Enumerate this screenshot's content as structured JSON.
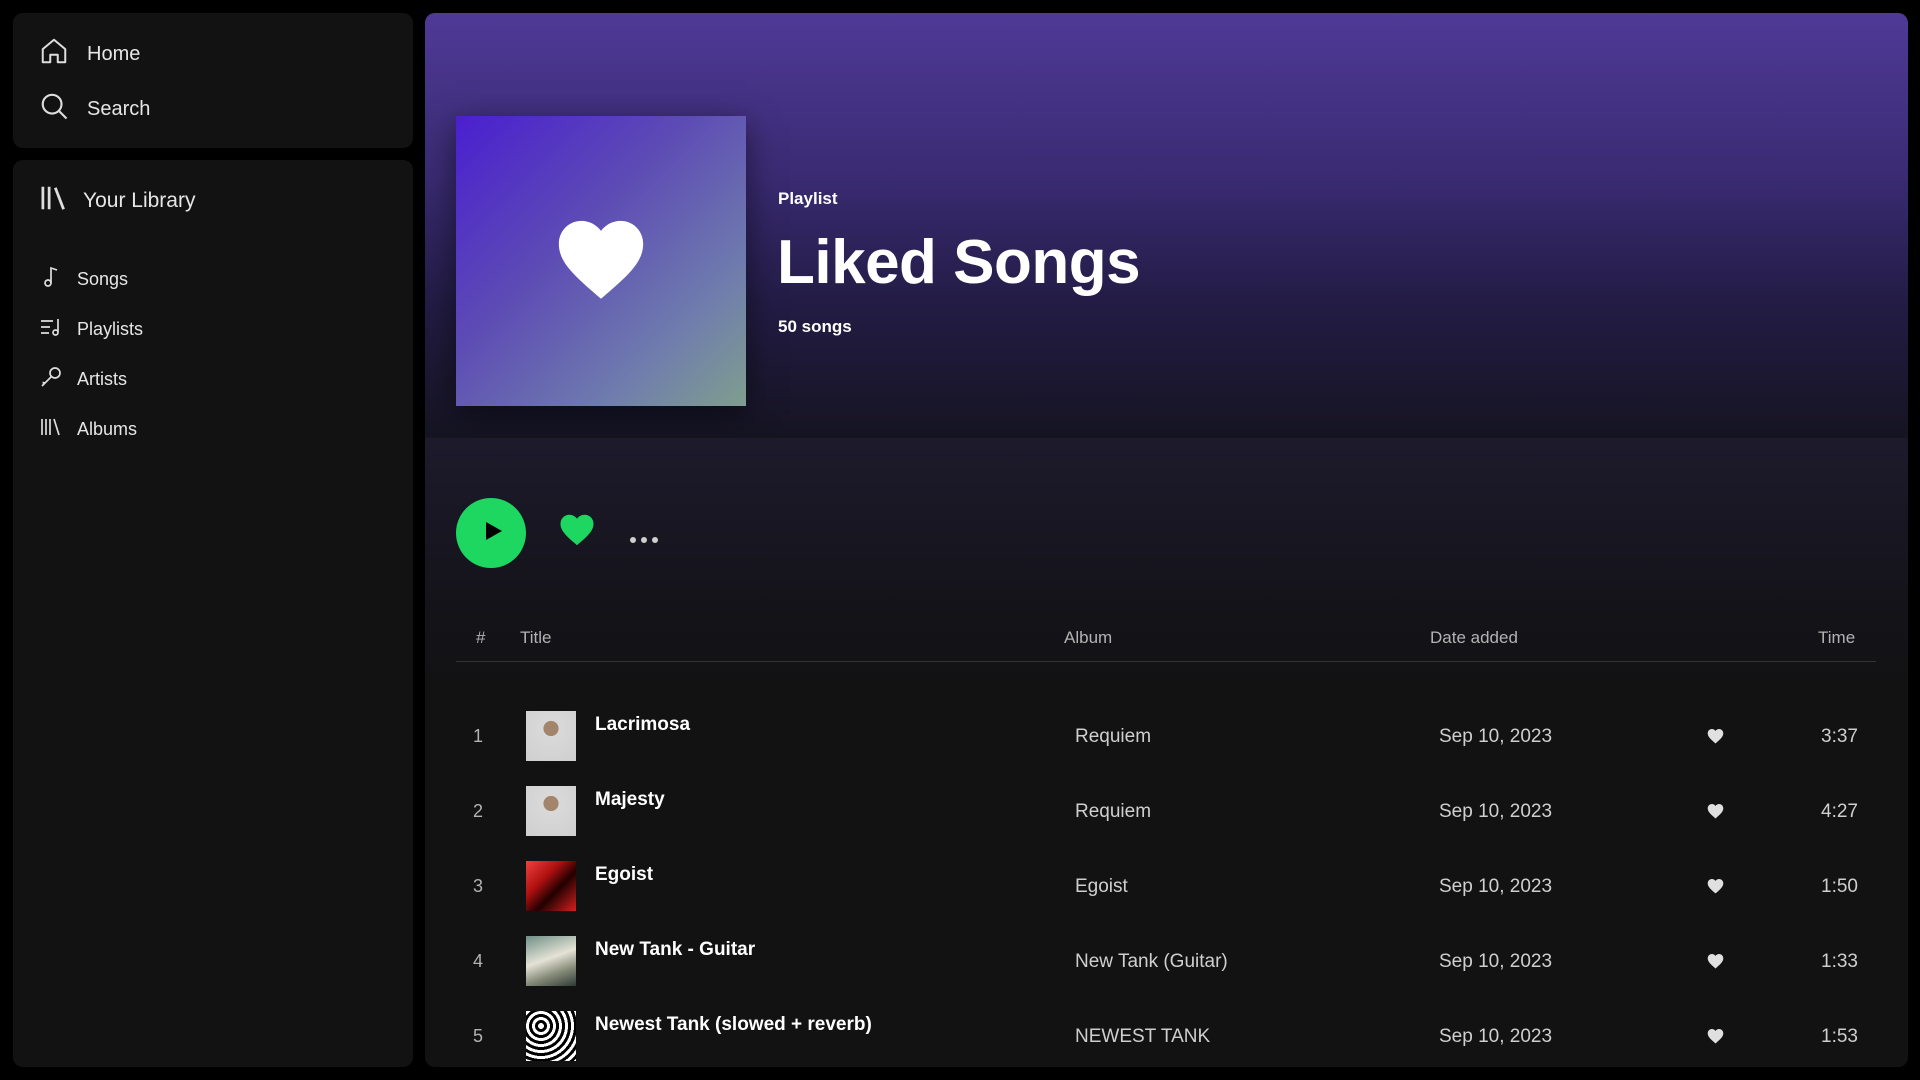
{
  "nav": {
    "home_label": "Home",
    "search_label": "Search"
  },
  "library": {
    "title": "Your Library",
    "items": [
      {
        "label": "Songs",
        "icon": "music-note-icon"
      },
      {
        "label": "Playlists",
        "icon": "playlist-icon"
      },
      {
        "label": "Artists",
        "icon": "microphone-icon"
      },
      {
        "label": "Albums",
        "icon": "albums-icon"
      }
    ]
  },
  "playlist": {
    "type_label": "Playlist",
    "title": "Liked Songs",
    "count_label": "50 songs",
    "cover_icon": "heart-icon"
  },
  "controls": {
    "play_icon": "play-icon",
    "like_icon": "heart-icon",
    "more_icon": "more-dots-icon"
  },
  "table": {
    "headers": {
      "number": "#",
      "title": "Title",
      "album": "Album",
      "date_added": "Date added",
      "time": "Time"
    },
    "rows": [
      {
        "number": "1",
        "title": "Lacrimosa",
        "album": "Requiem",
        "date_added": "Sep 10, 2023",
        "time": "3:37"
      },
      {
        "number": "2",
        "title": "Majesty",
        "album": "Requiem",
        "date_added": "Sep 10, 2023",
        "time": "4:27"
      },
      {
        "number": "3",
        "title": "Egoist",
        "album": "Egoist",
        "date_added": "Sep 10, 2023",
        "time": "1:50"
      },
      {
        "number": "4",
        "title": "New Tank - Guitar",
        "album": "New Tank (Guitar)",
        "date_added": "Sep 10, 2023",
        "time": "1:33"
      },
      {
        "number": "5",
        "title": "Newest Tank (slowed + reverb)",
        "album": "NEWEST TANK",
        "date_added": "Sep 10, 2023",
        "time": "1:53"
      }
    ]
  },
  "colors": {
    "accent_green": "#1ed760",
    "panel_bg": "#121212",
    "hero_purple": "#4f3a97"
  }
}
